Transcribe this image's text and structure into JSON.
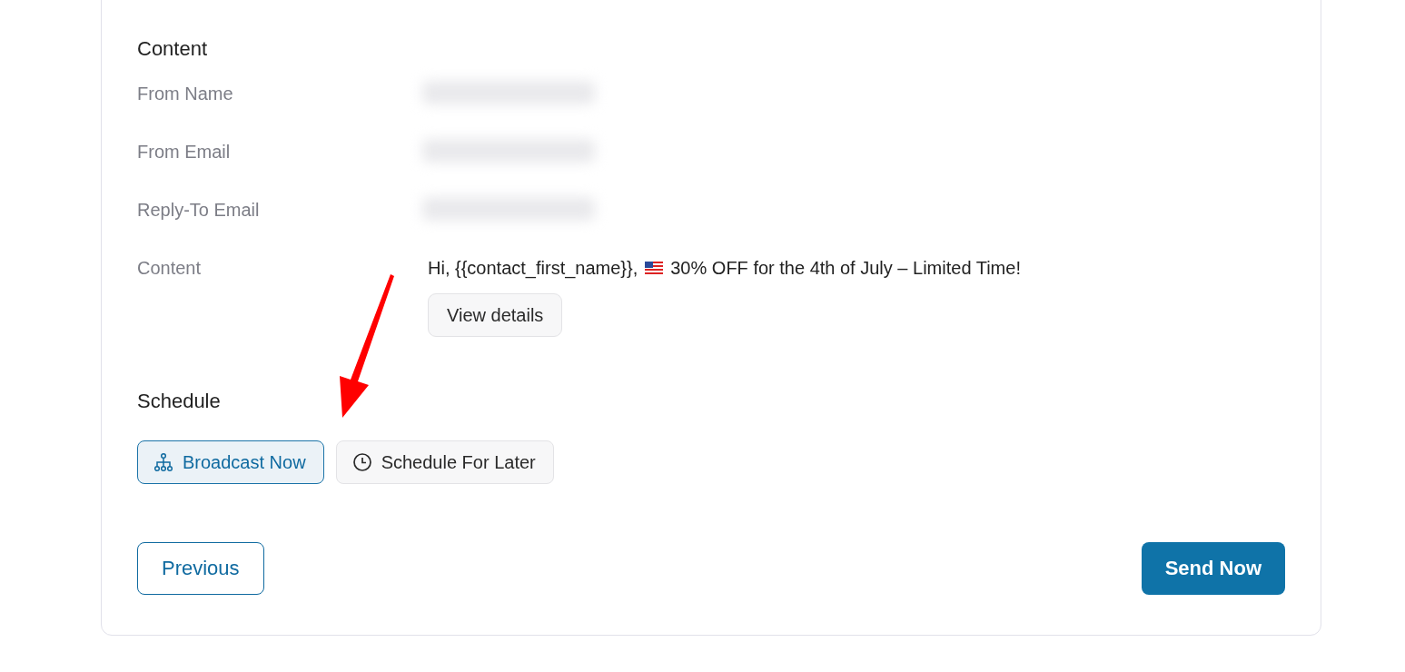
{
  "content": {
    "heading": "Content",
    "rows": [
      {
        "label": "From Name",
        "kind": "blurred"
      },
      {
        "label": "From Email",
        "kind": "blurred"
      },
      {
        "label": "Reply-To Email",
        "kind": "blurred"
      },
      {
        "label": "Content",
        "kind": "message",
        "text_before": "Hi, {{contact_first_name}},",
        "text_after": "30% OFF for the 4th of July – Limited Time!",
        "button": "View details"
      }
    ]
  },
  "schedule": {
    "heading": "Schedule",
    "options": [
      {
        "label": "Broadcast Now",
        "kind": "now",
        "selected": true
      },
      {
        "label": "Schedule For Later",
        "kind": "later",
        "selected": false
      }
    ]
  },
  "footer": {
    "previous": "Previous",
    "send": "Send Now"
  }
}
